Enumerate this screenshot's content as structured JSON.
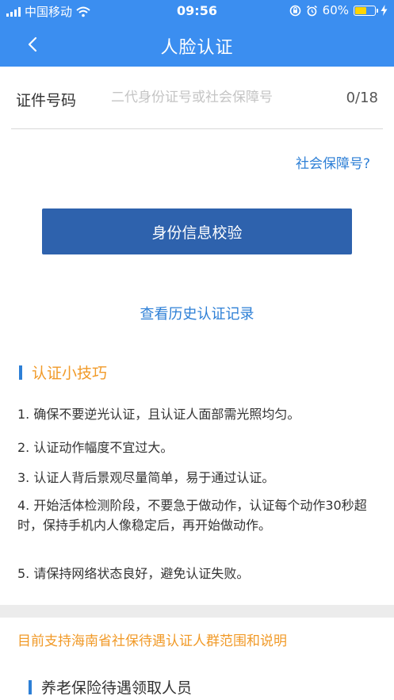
{
  "status_bar": {
    "carrier": "中国移动",
    "time": "09:56",
    "battery_percent": "60%",
    "battery_level": 0.6,
    "icons": [
      "signal-icon",
      "wifi-icon",
      "rotation-lock-icon",
      "alarm-icon",
      "battery-icon",
      "charging-icon"
    ]
  },
  "nav": {
    "title": "人脸认证",
    "back_icon": "chevron-left-icon"
  },
  "id_field": {
    "label": "证件号码",
    "placeholder": "二代身份证号或社会保障号",
    "value": "",
    "counter": "0/18"
  },
  "social_security_link": "社会保障号?",
  "verify_button": "身份信息校验",
  "history_link": "查看历史认证记录",
  "tips": {
    "title": "认证小技巧",
    "items": [
      "1. 确保不要逆光认证，且认证人面部需光照均匀。",
      "2. 认证动作幅度不宜过大。",
      "3. 认证人背后景观尽量简单，易于通过认证。",
      "4. 开始活体检测阶段，不要急于做动作，认证每个动作30秒超时，保持手机内人像稳定后，再开始做动作。",
      "5. 请保持网络状态良好，避免认证失败。"
    ]
  },
  "scope": {
    "title": "目前支持海南省社保待遇认证人群范围和说明",
    "section_title": "养老保险待遇领取人员"
  },
  "colors": {
    "header": "#3b8ef0",
    "button": "#2e62ad",
    "link": "#2d7fd6",
    "accent_orange": "#f19a28",
    "battery": "#ffd400"
  }
}
